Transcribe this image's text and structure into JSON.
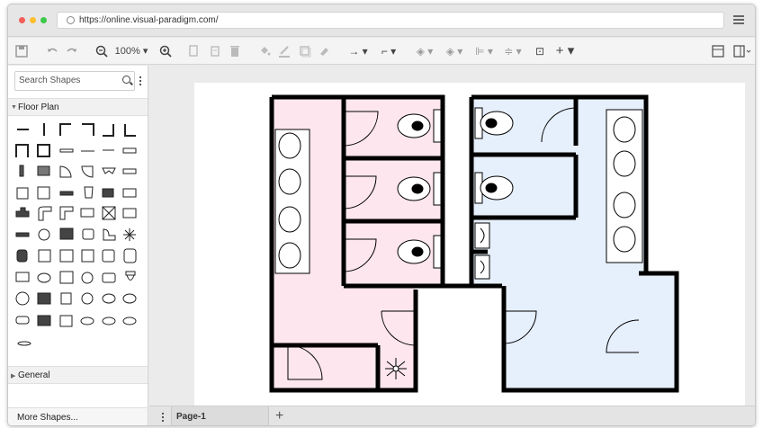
{
  "browser": {
    "url": "https://online.visual-paradigm.com/",
    "traffic_lights": [
      "#f25f58",
      "#fbbe2e",
      "#3cc94a"
    ]
  },
  "toolbar": {
    "zoom_level": "100%",
    "icons": [
      "save-icon",
      "undo-icon",
      "redo-icon",
      "zoom-out-icon",
      "zoom-in-icon",
      "copy-icon",
      "paste-icon",
      "delete-icon",
      "fill-color-icon",
      "line-color-icon",
      "shadow-icon",
      "format-painter-icon",
      "connector-icon",
      "waypoint-icon",
      "to-front-icon",
      "to-back-icon",
      "align-icon",
      "distribute-icon",
      "group-icon",
      "insert-icon",
      "format-panel-icon",
      "outline-panel-icon"
    ]
  },
  "sidebar": {
    "search_placeholder": "Search Shapes",
    "categories": [
      {
        "label": "Floor Plan",
        "expanded": true
      },
      {
        "label": "General",
        "expanded": false
      }
    ],
    "more_shapes": "More Shapes..."
  },
  "pages": {
    "tabs": [
      {
        "label": "Page-1"
      }
    ]
  },
  "colors": {
    "ladies_room": "#fde6ee",
    "mens_room": "#e6effc",
    "wall": "#000000"
  }
}
